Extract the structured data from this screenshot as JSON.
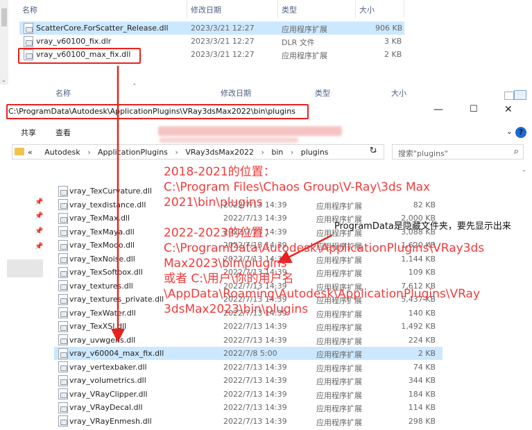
{
  "top_pane": {
    "columns": [
      "名称",
      "修改日期",
      "类型",
      "大小"
    ],
    "files": [
      {
        "name": "ScatterCore.ForScatter_Release.dll",
        "date": "2023/3/21 12:27",
        "type": "应用程序扩展",
        "size": "906 KB",
        "selected": true
      },
      {
        "name": "vray_v60100_fix.dlr",
        "date": "2023/3/21 12:27",
        "type": "DLR 文件",
        "size": "3 KB"
      },
      {
        "name": "vray_v60100_max_fix.dll",
        "date": "2023/3/21 12:27",
        "type": "应用程序扩展",
        "size": "2 KB"
      }
    ]
  },
  "window": {
    "title_path": "C:\\ProgramData\\Autodesk\\ApplicationPlugins\\VRay3dsMax2022\\bin\\plugins",
    "controls": {
      "minimize": "—",
      "maximize": "☐",
      "close": "✕"
    },
    "ribbon": {
      "share": "共享",
      "view": "查看",
      "help": "?"
    },
    "breadcrumb": {
      "overflow": "«",
      "items": [
        "Autodesk",
        "ApplicationPlugins",
        "VRay3dsMax2022",
        "bin",
        "plugins"
      ]
    },
    "search_placeholder": "搜索\"plugins\"",
    "columns": [
      "名称",
      "修改日期",
      "类型",
      "大小"
    ],
    "files": [
      {
        "name": "vray_TexCurvature.dll",
        "date": "",
        "type": "",
        "size": ""
      },
      {
        "name": "vray_texdistance.dll",
        "date": "2022/7/13 14:39",
        "type": "应用程序扩展",
        "size": "82 KB"
      },
      {
        "name": "vray_TexMax.dll",
        "date": "2022/7/13 14:39",
        "type": "应用程序扩展",
        "size": "2,000 KB"
      },
      {
        "name": "vray_TexMaya.dll",
        "date": "2022/7/13 14:39",
        "type": "应用程序扩展",
        "size": "3,088 KB"
      },
      {
        "name": "vray_TexModo.dll",
        "date": "2022/7/13 14:39",
        "type": "应用程序扩展",
        "size": "1,620 KB"
      },
      {
        "name": "vray_TexNoise.dll",
        "date": "2022/7/13 14:39",
        "type": "应用程序扩展",
        "size": "1,144 KB"
      },
      {
        "name": "vray_TexSoftbox.dll",
        "date": "2022/7/13 14:39",
        "type": "应用程序扩展",
        "size": "109 KB"
      },
      {
        "name": "vray_textures.dll",
        "date": "2022/7/13 14:39",
        "type": "应用程序扩展",
        "size": "7,612 KB"
      },
      {
        "name": "vray_textures_private.dll",
        "date": "2022/7/13 14:39",
        "type": "应用程序扩展",
        "size": "5,437 KB"
      },
      {
        "name": "vray_TexWater.dll",
        "date": "2022/7/13 14:39",
        "type": "应用程序扩展",
        "size": "140 KB"
      },
      {
        "name": "vray_TexXSI.dll",
        "date": "2022/7/13 14:39",
        "type": "应用程序扩展",
        "size": "1,492 KB"
      },
      {
        "name": "vray_uvwgens.dll",
        "date": "2022/7/13 14:39",
        "type": "应用程序扩展",
        "size": "224 KB"
      },
      {
        "name": "vray_v60004_max_fix.dll",
        "date": "2022/7/8 5:00",
        "type": "应用程序扩展",
        "size": "2 KB",
        "selected": true
      },
      {
        "name": "vray_vertexbaker.dll",
        "date": "2022/7/13 14:39",
        "type": "应用程序扩展",
        "size": "74 KB"
      },
      {
        "name": "vray_volumetrics.dll",
        "date": "2022/7/13 14:39",
        "type": "应用程序扩展",
        "size": "344 KB"
      },
      {
        "name": "vray_VRayClipper.dll",
        "date": "2022/7/13 14:39",
        "type": "应用程序扩展",
        "size": "184 KB"
      },
      {
        "name": "vray_VRayDecal.dll",
        "date": "2022/7/13 14:39",
        "type": "应用程序扩展",
        "size": "114 KB"
      },
      {
        "name": "vray_VRayEnmesh.dll",
        "date": "2022/7/13 14:39",
        "type": "应用程序扩展",
        "size": "298 KB"
      }
    ]
  },
  "annotations": {
    "red_main": "2018-2021的位置：\nC:\\Program Files\\Chaos Group\\V-Ray\\3ds Max\n2021\\bin\\plugins\n\n2022-2023的位置：\nC:\\ProgramData\\Autodesk\\ApplicationPlugins\\VRay3ds\nMax2023\\bin\\plugins\n或者 C:\\用户\\你的用户名\n\\AppData\\Roaming\\Autodesk\\ApplicationPlugins\\VRay\n3dsMax2023\\bin\\plugins",
    "black_note": "ProgramData是隐藏文件夹，要先显示出来"
  },
  "colors": {
    "annotation_red": "#f23a3a",
    "box_red": "#e8211d",
    "selection": "#cce8ff",
    "header_text": "#4d6082"
  }
}
